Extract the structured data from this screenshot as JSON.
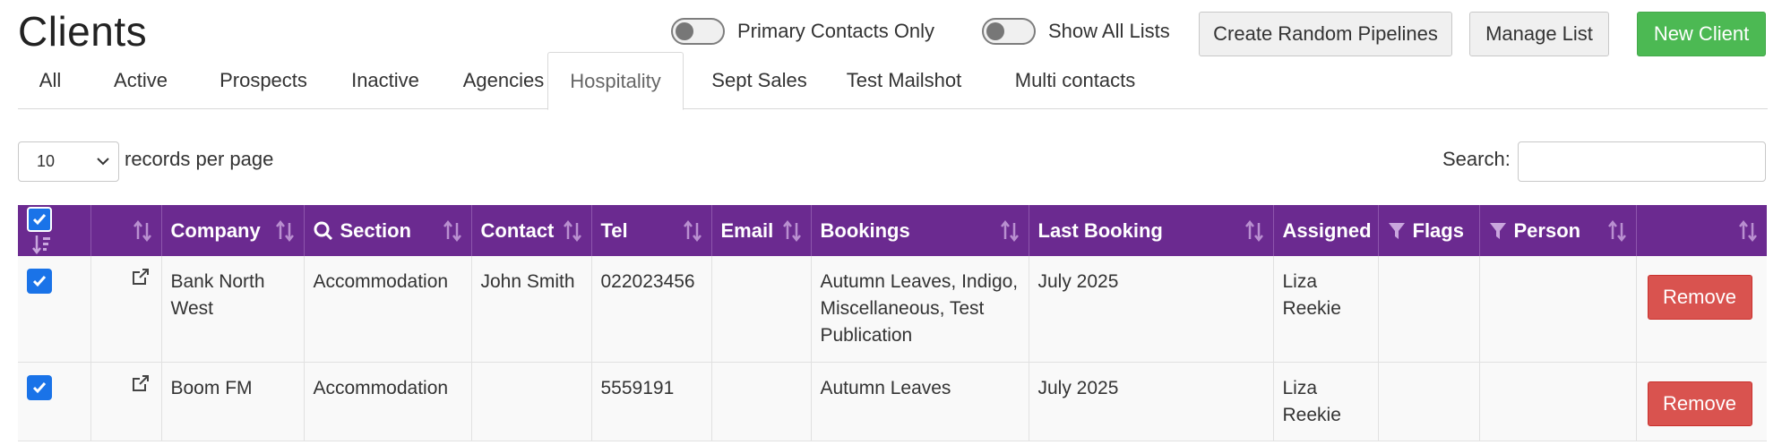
{
  "page": {
    "title": "Clients"
  },
  "toggles": [
    {
      "label": "Primary Contacts Only",
      "on": false
    },
    {
      "label": "Show All Lists",
      "on": false
    }
  ],
  "buttons": {
    "random_pipelines": "Create Random Pipelines",
    "manage_list": "Manage List",
    "new_client": "New Client"
  },
  "tabs": [
    {
      "label": "All"
    },
    {
      "label": "Active"
    },
    {
      "label": "Prospects"
    },
    {
      "label": "Inactive"
    },
    {
      "label": "Agencies"
    },
    {
      "label": "Hospitality",
      "active": true
    },
    {
      "label": "Sept Sales"
    },
    {
      "label": "Test Mailshot"
    },
    {
      "label": "Multi contacts"
    }
  ],
  "length": {
    "value": "10",
    "label": "records per page"
  },
  "search": {
    "label": "Search:",
    "value": ""
  },
  "table": {
    "columns": [
      "",
      "",
      "Company",
      "Section",
      "Contact",
      "Tel",
      "Email",
      "Bookings",
      "Last Booking",
      "Assigned",
      "Flags",
      "Person",
      ""
    ],
    "rows": [
      {
        "checked": true,
        "company": "Bank North West",
        "section": "Accommodation",
        "contact": "John Smith",
        "tel": "022023456",
        "email": "",
        "bookings": "Autumn Leaves, Indigo, Miscellaneous, Test Publication",
        "last_booking": "July 2025",
        "assigned": "Liza Reekie",
        "flags": "",
        "person": "",
        "action": "Remove"
      },
      {
        "checked": true,
        "company": "Boom FM",
        "section": "Accommodation",
        "contact": "",
        "tel": "5559191",
        "email": "",
        "bookings": "Autumn Leaves",
        "last_booking": "July 2025",
        "assigned": "Liza Reekie",
        "flags": "",
        "person": "",
        "action": "Remove"
      }
    ]
  },
  "colors": {
    "header_bg": "#6b2a90",
    "success": "#4cb953",
    "danger": "#d9534f",
    "checkbox": "#1a73e8",
    "arrow": "#e8201c"
  }
}
